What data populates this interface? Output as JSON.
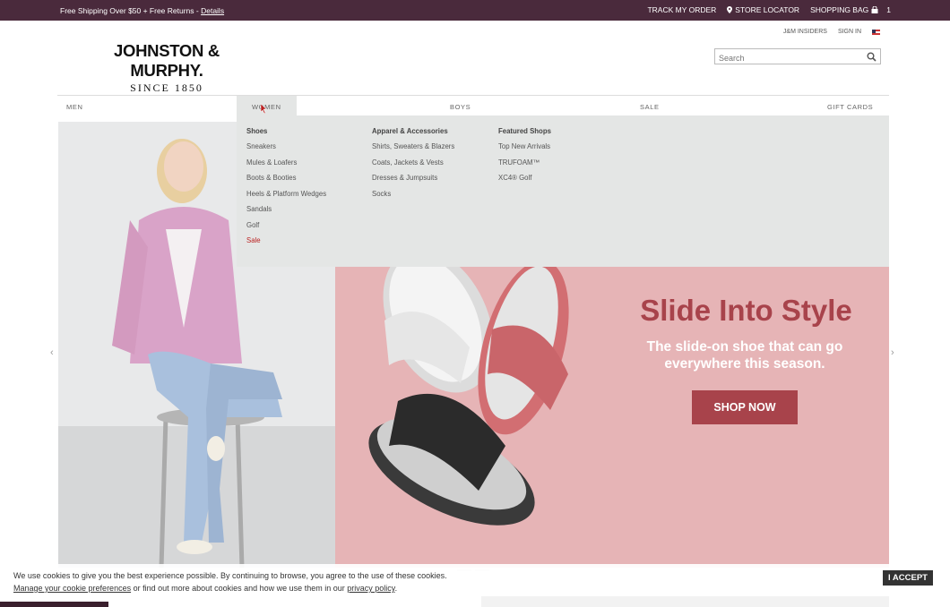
{
  "topbar": {
    "promo_text": "Free Shipping Over $50 + Free Returns - ",
    "promo_link": "Details",
    "track_order": "TRACK MY ORDER",
    "store_locator": "STORE LOCATOR",
    "shopping_bag": "SHOPPING BAG",
    "bag_count": "1"
  },
  "logo": {
    "brand": "JOHNSTON & MURPHY.",
    "since": "SINCE 1850"
  },
  "utility": {
    "insiders": "J&M INSIDERS",
    "sign_in": "SIGN IN"
  },
  "search": {
    "placeholder": "Search"
  },
  "nav": {
    "men": "MEN",
    "women": "WOMEN",
    "boys": "BOYS",
    "sale": "SALE",
    "gift_cards": "GIFT CARDS"
  },
  "menu": {
    "shoes": {
      "head": "Shoes",
      "items": [
        "Sneakers",
        "Mules & Loafers",
        "Boots & Booties",
        "Heels & Platform Wedges",
        "Sandals",
        "Golf",
        "Sale"
      ]
    },
    "apparel": {
      "head": "Apparel & Accessories",
      "items": [
        "Shirts, Sweaters & Blazers",
        "Coats, Jackets & Vests",
        "Dresses & Jumpsuits",
        "Socks"
      ]
    },
    "featured": {
      "head": "Featured Shops",
      "items": [
        "Top New Arrivals",
        "TRUFOAM™",
        "XC4® Golf"
      ]
    }
  },
  "hero": {
    "headline": "Slide Into Style",
    "subline": "The slide-on shoe that can go everywhere this season.",
    "cta": "SHOP NOW"
  },
  "cookie": {
    "line1": "We use cookies to give you the best experience possible. By continuing to browse, you agree to the use of these cookies.",
    "manage_link": "Manage your cookie preferences",
    "line2_mid": " or find out more about cookies and how we use them in our ",
    "privacy_link": "privacy policy",
    "line2_end": ".",
    "accept": "I ACCEPT"
  },
  "colors": {
    "topbar": "#4a2a3c",
    "accent": "#a8434b",
    "menu_bg": "#e4e6e5",
    "hero_bg": "#e6b4b6"
  }
}
